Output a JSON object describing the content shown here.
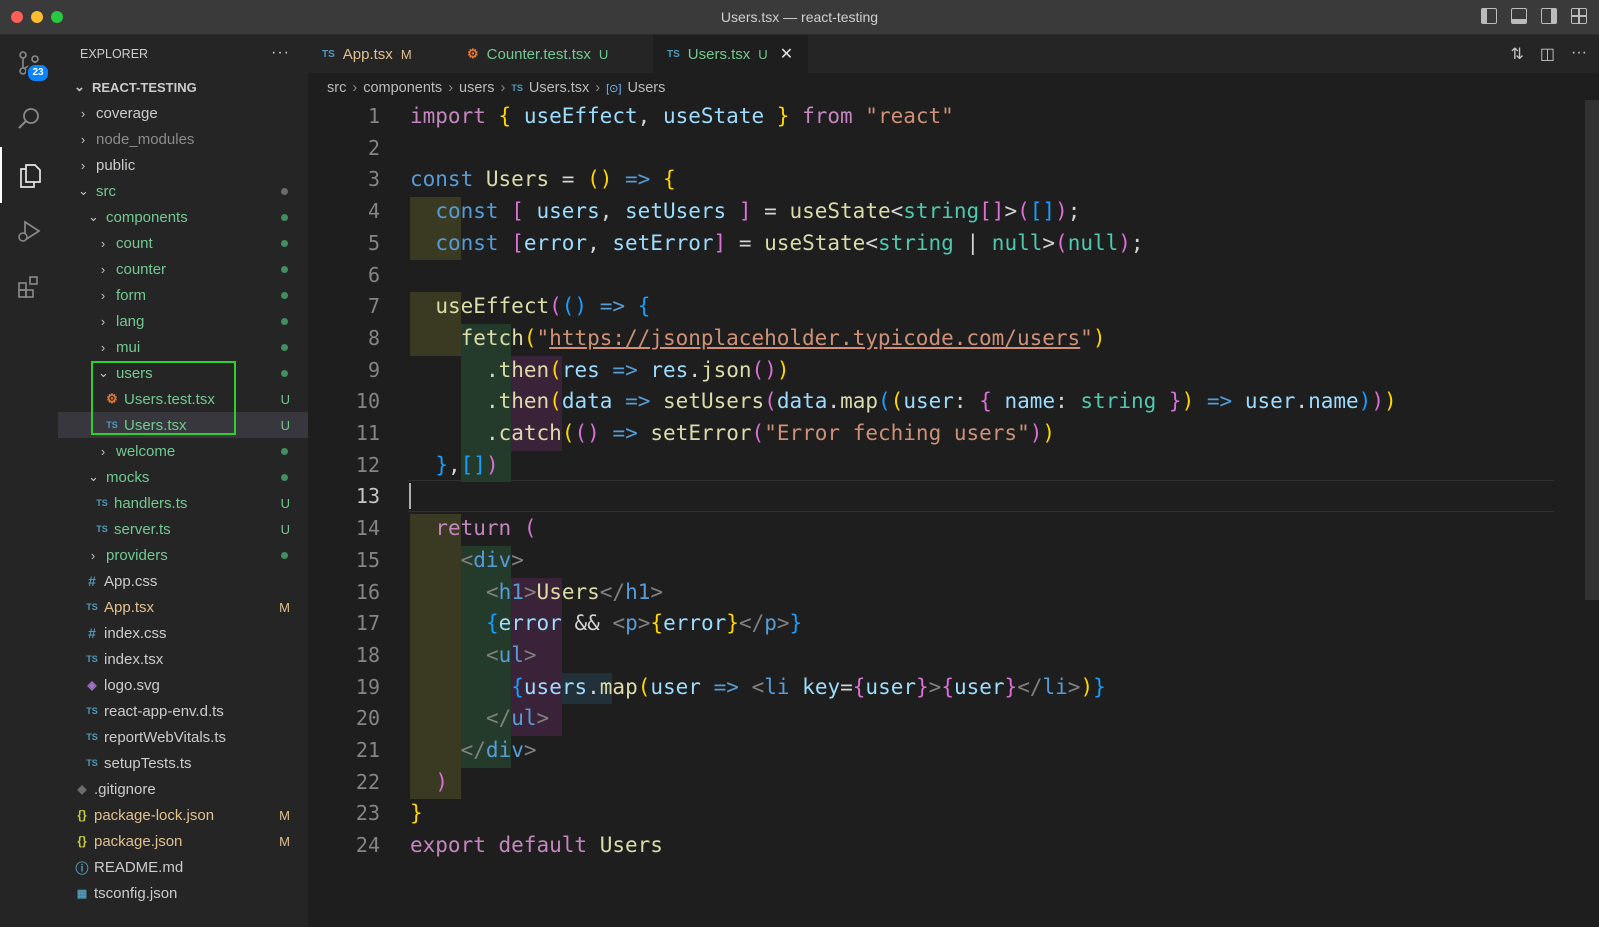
{
  "window": {
    "title": "Users.tsx — react-testing"
  },
  "activity_bar": {
    "source_control_badge": "23"
  },
  "explorer": {
    "header": "EXPLORER",
    "project": "REACT-TESTING",
    "items": [
      {
        "label": "coverage",
        "status": ""
      },
      {
        "label": "node_modules",
        "status": ""
      },
      {
        "label": "public",
        "status": ""
      },
      {
        "label": "src",
        "status": ""
      },
      {
        "label": "components",
        "status": ""
      },
      {
        "label": "count",
        "status": ""
      },
      {
        "label": "counter",
        "status": ""
      },
      {
        "label": "form",
        "status": ""
      },
      {
        "label": "lang",
        "status": ""
      },
      {
        "label": "mui",
        "status": ""
      },
      {
        "label": "users",
        "status": ""
      },
      {
        "label": "Users.test.tsx",
        "status": "U"
      },
      {
        "label": "Users.tsx",
        "status": "U"
      },
      {
        "label": "welcome",
        "status": ""
      },
      {
        "label": "mocks",
        "status": ""
      },
      {
        "label": "handlers.ts",
        "status": "U"
      },
      {
        "label": "server.ts",
        "status": "U"
      },
      {
        "label": "providers",
        "status": ""
      },
      {
        "label": "App.css",
        "status": ""
      },
      {
        "label": "App.tsx",
        "status": "M"
      },
      {
        "label": "index.css",
        "status": ""
      },
      {
        "label": "index.tsx",
        "status": ""
      },
      {
        "label": "logo.svg",
        "status": ""
      },
      {
        "label": "react-app-env.d.ts",
        "status": ""
      },
      {
        "label": "reportWebVitals.ts",
        "status": ""
      },
      {
        "label": "setupTests.ts",
        "status": ""
      },
      {
        "label": ".gitignore",
        "status": ""
      },
      {
        "label": "package-lock.json",
        "status": "M"
      },
      {
        "label": "package.json",
        "status": "M"
      },
      {
        "label": "README.md",
        "status": ""
      },
      {
        "label": "tsconfig.json",
        "status": ""
      }
    ]
  },
  "tabs": [
    {
      "label": "App.tsx",
      "status": "M"
    },
    {
      "label": "Counter.test.tsx",
      "status": "U"
    },
    {
      "label": "Users.tsx",
      "status": "U"
    }
  ],
  "breadcrumb": [
    "src",
    "components",
    "users",
    "Users.tsx",
    "Users"
  ],
  "editor": {
    "line_numbers": [
      "1",
      "2",
      "3",
      "4",
      "5",
      "6",
      "7",
      "8",
      "9",
      "10",
      "11",
      "12",
      "13",
      "14",
      "15",
      "16",
      "17",
      "18",
      "19",
      "20",
      "21",
      "22",
      "23",
      "24"
    ],
    "current_line": "13",
    "lines": [
      "import { useEffect, useState } from \"react\"",
      "",
      "const Users = () => {",
      "  const [ users, setUsers ] = useState<string[]>([]);",
      "  const [error, setError] = useState<string | null>(null);",
      "",
      "  useEffect(() => {",
      "    fetch(\"https://jsonplaceholder.typicode.com/users\")",
      "      .then(res => res.json())",
      "      .then(data => setUsers(data.map((user: { name: string }) => user.name)))",
      "      .catch(() => setError(\"Error feching users\"))",
      "  },[])",
      "",
      "  return (",
      "    <div>",
      "      <h1>Users</h1>",
      "      {error && <p>{error}</p>}",
      "      <ul>",
      "        {users.map(user => <li key={user}>{user}</li>)}",
      "      </ul>",
      "    </div>",
      "  )",
      "}",
      "export default Users"
    ]
  },
  "colors": {
    "accent": "#0b84ff",
    "highlight_box": "#2fcf2f",
    "modified": "#e2c08d",
    "untracked": "#73c991"
  }
}
